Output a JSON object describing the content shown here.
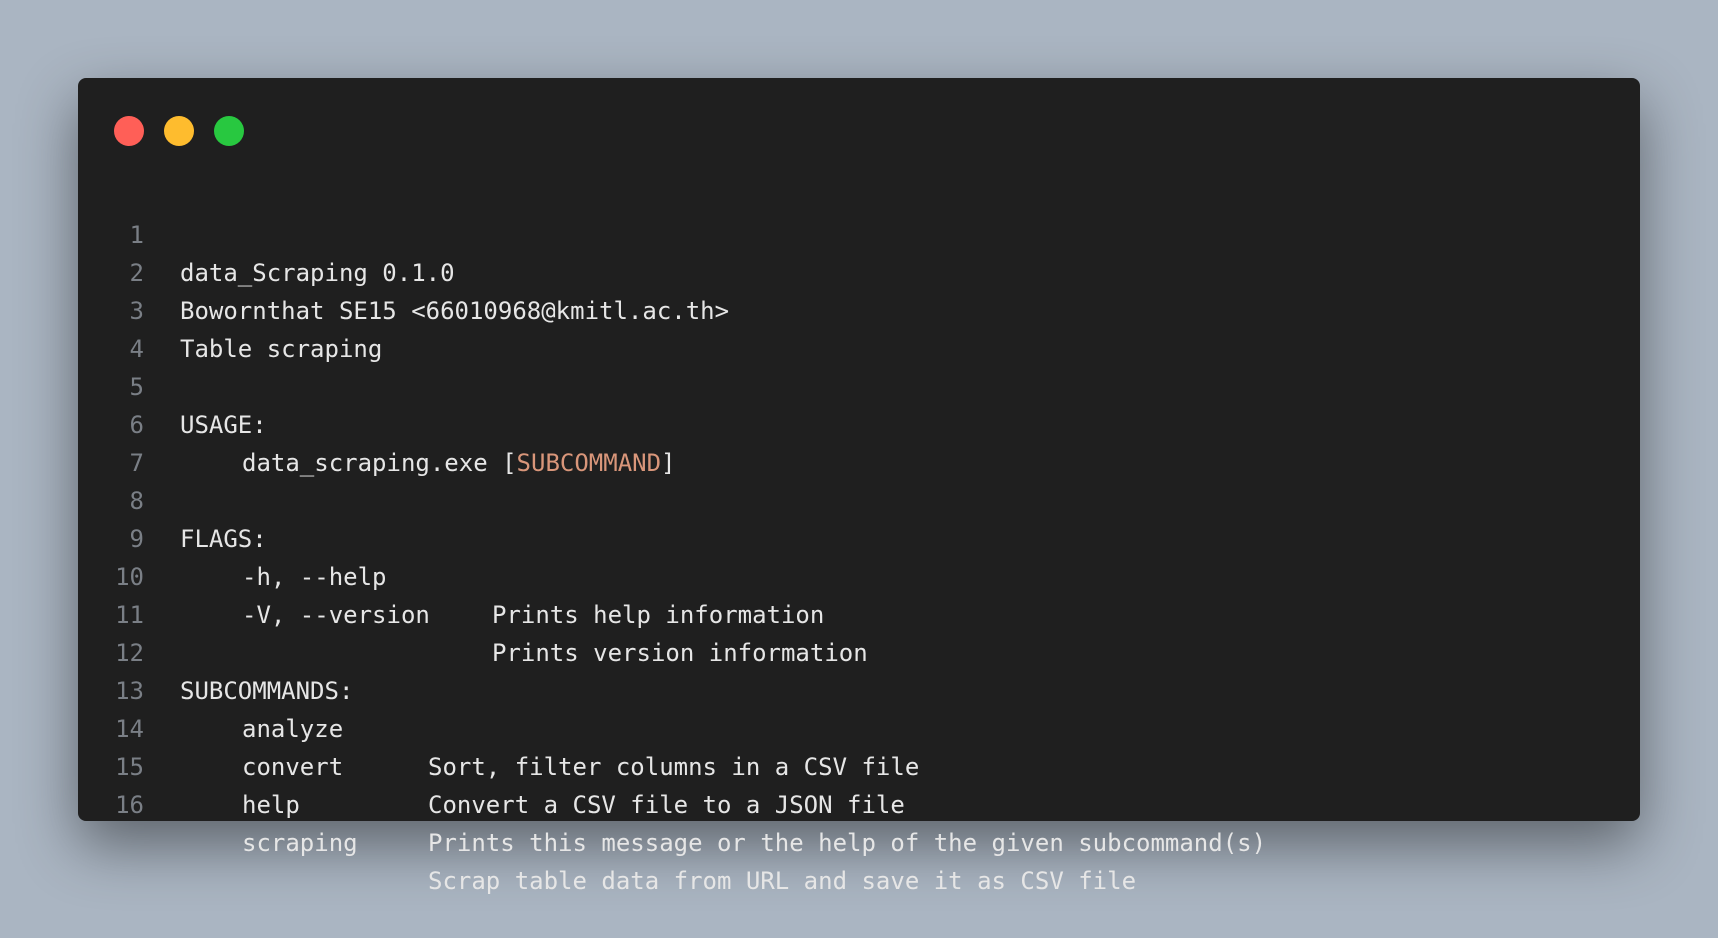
{
  "colors": {
    "background": "#aab5c2",
    "editor": "#1f1f1f",
    "text": "#e6e6e6",
    "line_number": "#7a7f86",
    "highlight": "#d9967a",
    "dot_red": "#ff5f57",
    "dot_yellow": "#febc2e",
    "dot_green": "#28c840"
  },
  "lines": [
    {
      "n": "1",
      "text": "data_Scraping 0.1.0"
    },
    {
      "n": "2",
      "text": "Bowornthat SE15 <66010968@kmitl.ac.th>"
    },
    {
      "n": "3",
      "text": "Table scraping"
    },
    {
      "n": "4"
    },
    {
      "n": "5",
      "text": "USAGE:"
    },
    {
      "n": "6",
      "pre": "data_scraping.exe [",
      "hl": "SUBCOMMAND",
      "post": "]"
    },
    {
      "n": "7"
    },
    {
      "n": "8",
      "text": "FLAGS:"
    },
    {
      "n": "9",
      "key": "-h, --help",
      "desc": "Prints help information"
    },
    {
      "n": "10",
      "key": "-V, --version",
      "desc": "Prints version information"
    },
    {
      "n": "11"
    },
    {
      "n": "12",
      "text": "SUBCOMMANDS:"
    },
    {
      "n": "13",
      "key": "analyze",
      "desc": "Sort, filter columns in a CSV file"
    },
    {
      "n": "14",
      "key": "convert",
      "desc": "Convert a CSV file to a JSON file"
    },
    {
      "n": "15",
      "key": "help",
      "desc": "Prints this message or the help of the given subcommand(s)"
    },
    {
      "n": "16",
      "key": "scraping",
      "desc": "Scrap table data from URL and save it as CSV file"
    }
  ]
}
